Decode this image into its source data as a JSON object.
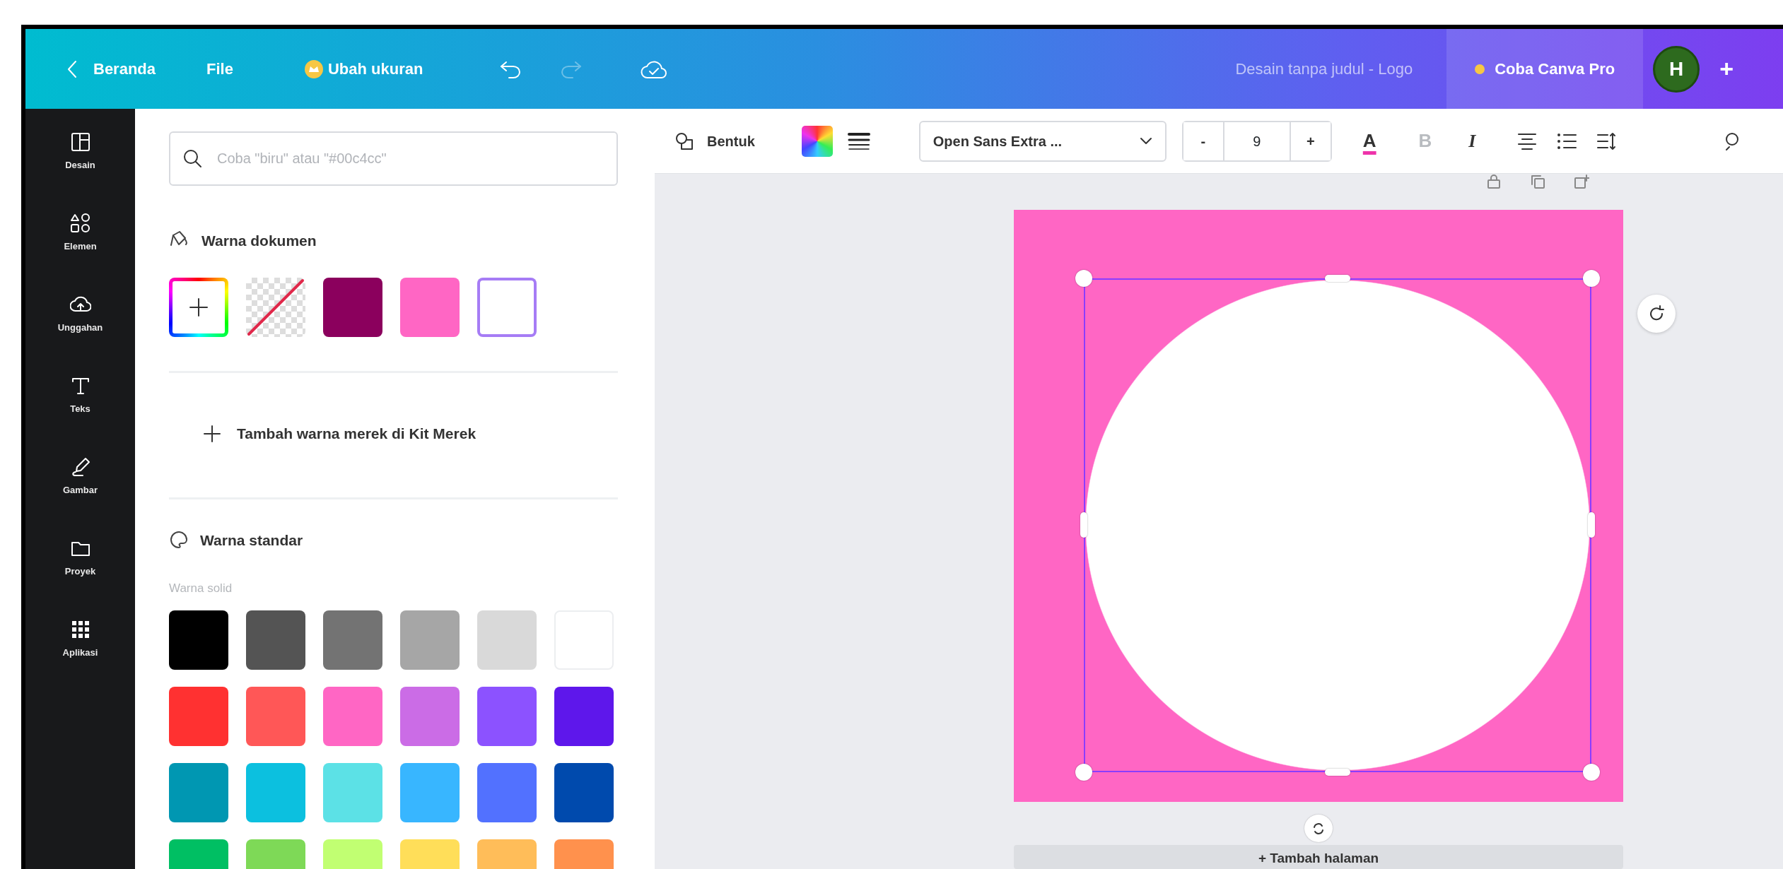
{
  "topbar": {
    "back_label": "Beranda",
    "menu": [
      {
        "kind": "text",
        "label": "File"
      },
      {
        "kind": "resize",
        "label": "Ubah ukuran"
      }
    ],
    "undo": {
      "disabled": false
    },
    "redo": {
      "disabled": true
    },
    "title": "Desain tanpa judul - Logo",
    "pro_button": "Coba Canva Pro",
    "avatar": "H",
    "add": "+"
  },
  "sidebar": {
    "items": [
      {
        "kind": "layout",
        "label": "Desain"
      },
      {
        "kind": "elements",
        "label": "Elemen"
      },
      {
        "kind": "upload",
        "label": "Unggahan"
      },
      {
        "kind": "text",
        "label": "Teks"
      },
      {
        "kind": "draw",
        "label": "Gambar"
      },
      {
        "kind": "folder",
        "label": "Proyek"
      },
      {
        "kind": "apps",
        "label": "Aplikasi"
      }
    ]
  },
  "color_panel": {
    "search": {
      "placeholder": "Coba \"biru\" atau \"#00c4cc\""
    },
    "document_colors": {
      "title": "Warna dokumen",
      "swatches": [
        {
          "kind": "add",
          "selected": false
        },
        {
          "kind": "transparent",
          "selected": false
        },
        {
          "kind": "color",
          "color": "#8b005d",
          "selected": false
        },
        {
          "kind": "color",
          "color": "#ff66c4",
          "selected": false
        },
        {
          "kind": "color",
          "color": "#ffffff",
          "selected": true
        }
      ]
    },
    "brand_link": "Tambah warna merek di Kit Merek",
    "standard_colors": {
      "title": "Warna standar",
      "subtitle": "Warna solid",
      "swatches": [
        {
          "color": "#000000"
        },
        {
          "color": "#545454"
        },
        {
          "color": "#737373"
        },
        {
          "color": "#a6a6a6"
        },
        {
          "color": "#d9d9d9"
        },
        {
          "color": "#ffffff"
        },
        {
          "color": "#ff3131"
        },
        {
          "color": "#ff5757"
        },
        {
          "color": "#ff66c4"
        },
        {
          "color": "#cb6ce6"
        },
        {
          "color": "#8c52ff"
        },
        {
          "color": "#5e17eb"
        },
        {
          "color": "#0097b2"
        },
        {
          "color": "#0cc0df"
        },
        {
          "color": "#5ce1e6"
        },
        {
          "color": "#38b6ff"
        },
        {
          "color": "#5271ff"
        },
        {
          "color": "#004aad"
        },
        {
          "color": "#00bf63"
        },
        {
          "color": "#7ed957"
        },
        {
          "color": "#c1ff72"
        },
        {
          "color": "#ffde59"
        },
        {
          "color": "#ffbd59"
        },
        {
          "color": "#ff914d"
        }
      ]
    }
  },
  "toolbar": {
    "shape_button": "Bentuk",
    "font": "Open Sans Extra ...",
    "decrease": "-",
    "font_size": "9",
    "increase": "+",
    "text_color": "A",
    "bold": {
      "label": "B",
      "disabled": true
    },
    "italic": {
      "label": "I",
      "disabled": false
    }
  },
  "canvas": {
    "add_page": "+ Tambah halaman"
  }
}
